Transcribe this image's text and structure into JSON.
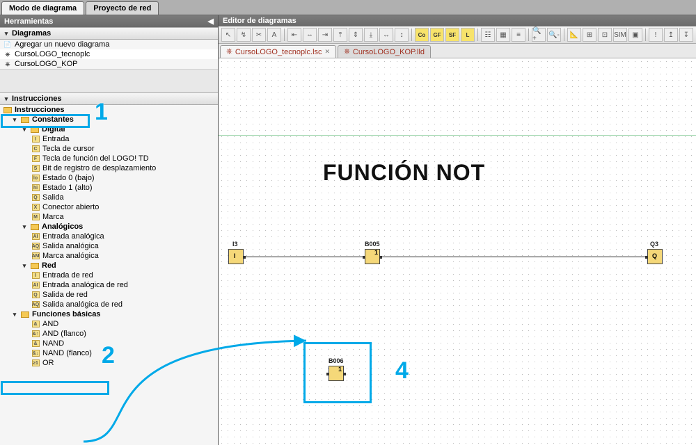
{
  "top_tabs": {
    "diagram_mode": "Modo de diagrama",
    "net_project": "Proyecto de red"
  },
  "left": {
    "tools_header": "Herramientas",
    "diagrams_header": "Diagramas",
    "add_new": "Agregar un nuevo diagrama",
    "diag1": "CursoLOGO_tecnoplc",
    "diag2": "CursoLOGO_KOP",
    "instr_header": "Instrucciones",
    "root": "Instrucciones",
    "constants": "Constantes",
    "digital": "Digital",
    "digital_items": {
      "entrada": "Entrada",
      "cursor": "Tecla de cursor",
      "logotd": "Tecla de función del LOGO! TD",
      "bitreg": "Bit de registro de desplazamiento",
      "est0": "Estado 0 (bajo)",
      "est1": "Estado 1 (alto)",
      "salida": "Salida",
      "conab": "Conector abierto",
      "marca": "Marca"
    },
    "analog": "Analógicos",
    "analog_items": {
      "ea": "Entrada analógica",
      "sa": "Salida analógica",
      "ma": "Marca analógica"
    },
    "red": "Red",
    "red_items": {
      "er": "Entrada de red",
      "ear": "Entrada analógica de red",
      "sr": "Salida de red",
      "sar": "Salida analógica de red"
    },
    "basic": "Funciones básicas",
    "basic_items": {
      "and": "AND",
      "andf": "AND (flanco)",
      "nand": "NAND",
      "nandf": "NAND (flanco)",
      "or": "OR"
    }
  },
  "right": {
    "editor_header": "Editor de diagramas",
    "tab1": "CursoLOGO_tecnoplc.lsc",
    "tab2": "CursoLOGO_KOP.lld"
  },
  "canvas": {
    "title": "FUNCIÓN NOT",
    "blocks": {
      "i3": "I3",
      "i": "I",
      "b005": "B005",
      "one": "1",
      "q3": "Q3",
      "q": "Q",
      "b006": "B006"
    }
  },
  "annotations": {
    "n1": "1",
    "n2": "2",
    "n4": "4"
  }
}
